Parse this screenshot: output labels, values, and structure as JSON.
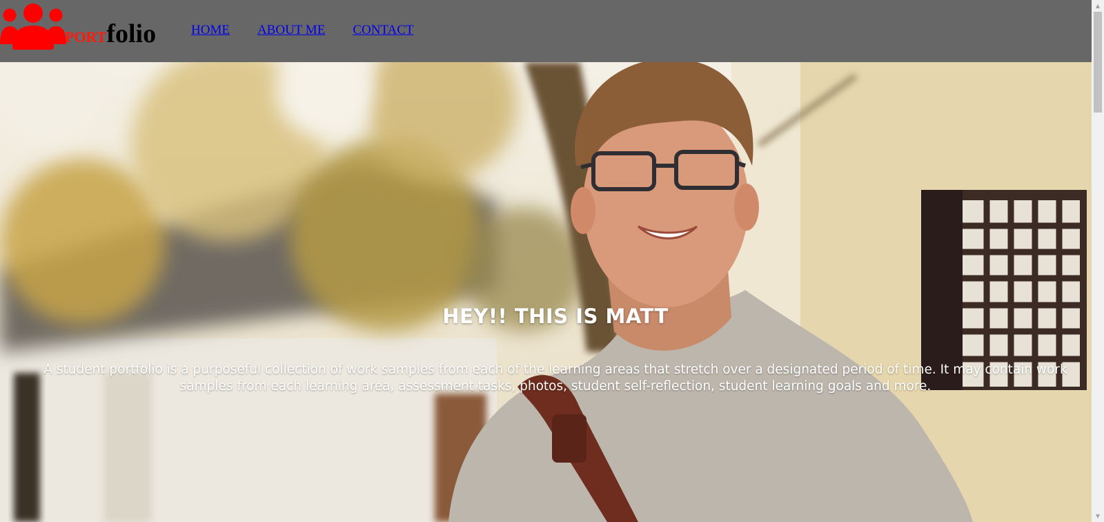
{
  "brand": {
    "part1": "PORT",
    "part2": "folio"
  },
  "nav": {
    "items": [
      "HOME",
      "ABOUT ME",
      "CONTACT"
    ]
  },
  "hero": {
    "title": "HEY!! THIS IS MATT",
    "description": "A student portfolio is a purposeful collection of work samples from each of the learning areas that stretch over a designated period of time. It may contain work samples from each learning area, assessment tasks, photos, student self-reflection, student learning goals and more."
  },
  "colors": {
    "header_bg": "#676767",
    "logo_icon": "#ff0000",
    "brand_accent": "#ff1a0d",
    "link": "#0000ee"
  },
  "icons": {
    "logo": "group-users-icon",
    "scroll_up": "arrow-up-icon",
    "scroll_down": "arrow-down-icon"
  }
}
